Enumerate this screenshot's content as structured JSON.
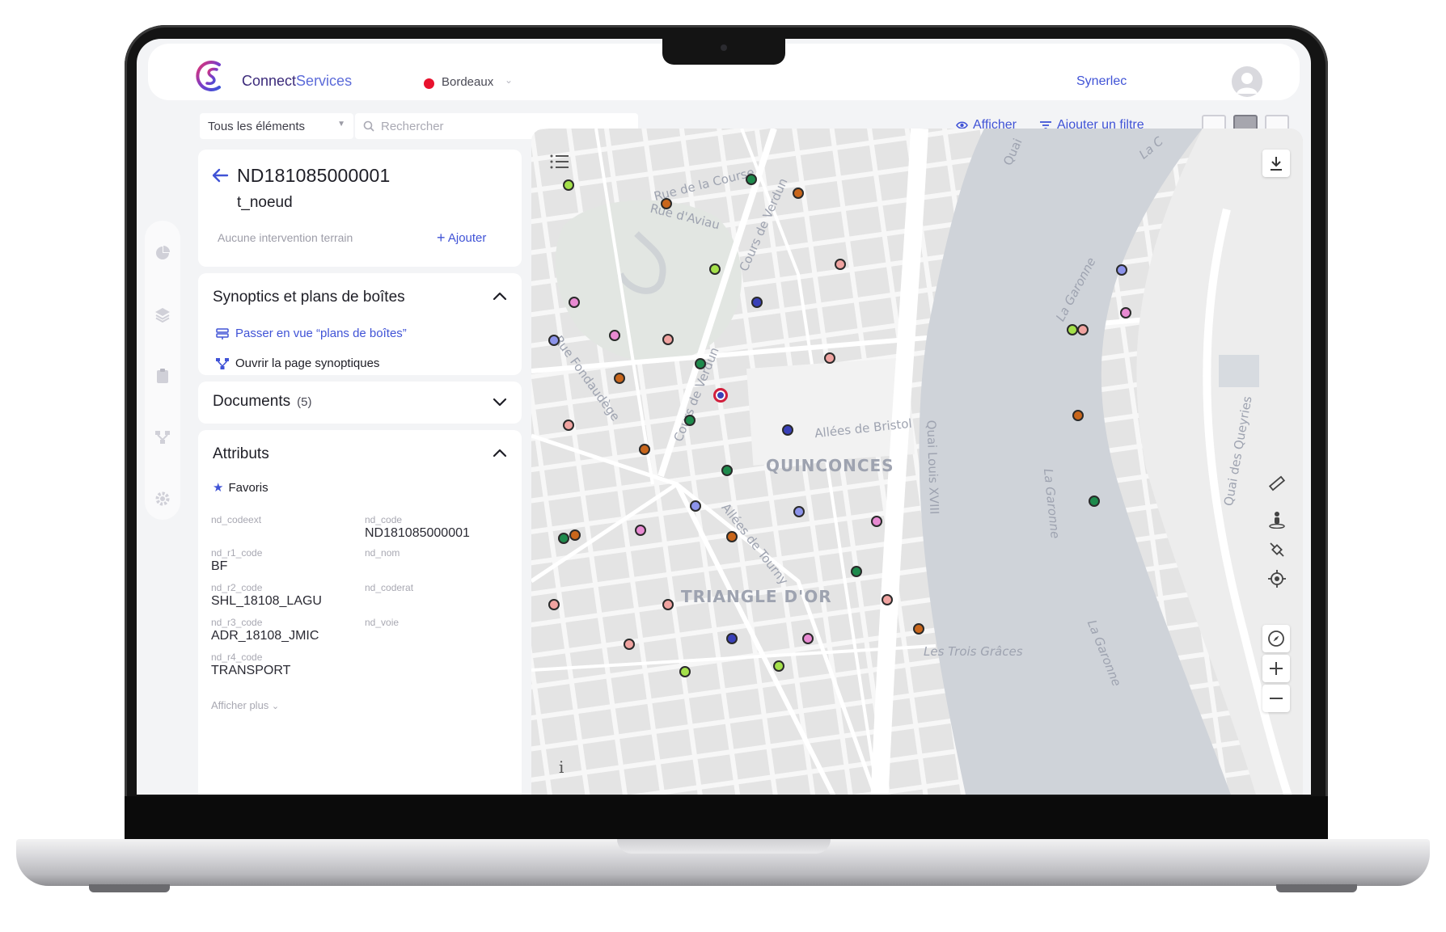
{
  "app": {
    "brand_part1": "Connect",
    "brand_part2": "Services",
    "city": "Bordeaux",
    "organization": "Synerlec"
  },
  "toolbar": {
    "filter_select": "Tous les éléments",
    "search_placeholder": "Rechercher",
    "show_label": "Afficher",
    "add_filter_label": "Ajouter un filtre"
  },
  "node": {
    "id": "ND181085000001",
    "type": "t_noeud",
    "no_intervention": "Aucune intervention terrain",
    "add_label": "Ajouter"
  },
  "synoptics": {
    "title": "Synoptics et plans de boîtes",
    "switch_view_label": "Passer en vue “plans de boîtes”",
    "open_page_label": "Ouvrir la page synoptiques",
    "expanded": true
  },
  "documents": {
    "title": "Documents",
    "count": "(5)",
    "expanded": false
  },
  "attributes": {
    "title": "Attributs",
    "favorites_label": "Favoris",
    "items": [
      {
        "label": "nd_codeext",
        "value": ""
      },
      {
        "label": "nd_code",
        "value": "ND181085000001"
      },
      {
        "label": "nd_r1_code",
        "value": "BF"
      },
      {
        "label": "nd_nom",
        "value": ""
      },
      {
        "label": "nd_r2_code",
        "value": "SHL_18108_LAGU"
      },
      {
        "label": "nd_coderat",
        "value": ""
      },
      {
        "label": "nd_r3_code",
        "value": "ADR_18108_JMIC"
      },
      {
        "label": "nd_voie",
        "value": ""
      },
      {
        "label": "nd_r4_code",
        "value": "TRANSPORT"
      }
    ],
    "show_more": "Afficher plus"
  },
  "map": {
    "labels": {
      "rue_course": "Rue de la Course",
      "rue_aviau": "Rue d'Aviau",
      "cours_verdun_1": "Cours de Verdun",
      "cours_verdun_2": "Cours de Verdun",
      "rue_fondaudege": "Rue Fondaudège",
      "allees_bristol": "Allées de Bristol",
      "quinconces": "QUINCONCES",
      "quai_louis": "Quai Louis XVIII",
      "allees_tourny": "Allées de Tourny",
      "triangle_or": "TRIANGLE D'OR",
      "trois_graces": "Les Trois Grâces",
      "garonne_1": "La Garonne",
      "garonne_2": "La Garonne",
      "garonne_3": "La Garonne",
      "quai_queyries": "Quai des Queyries",
      "quai_top": "Quai",
      "la_top": "La C",
      "info": "i"
    },
    "marker_colors": {
      "lime": "#a4e04a",
      "green": "#1e8a4c",
      "orange": "#c9661b",
      "salmon": "#f0a3a0",
      "pink": "#e88ad2",
      "blue": "#8c93ea",
      "navy": "#3940b8"
    },
    "selected_marker_color": "#3940b8"
  },
  "colors": {
    "accent": "#4053d6",
    "brand_dark": "#3b2a7a",
    "status_red": "#e8112d"
  },
  "icons": [
    "search-icon",
    "eye-icon",
    "filter-icon",
    "layout-icon",
    "back-arrow-icon",
    "plus-icon",
    "chevron-up-icon",
    "chevron-down-icon",
    "boxes-icon",
    "synoptic-icon",
    "star-icon",
    "list-icon",
    "download-icon",
    "ruler-icon",
    "street-view-icon",
    "satellite-icon",
    "locate-icon",
    "compass-icon",
    "zoom-in-icon",
    "zoom-out-icon",
    "pie-chart-icon",
    "layers-icon",
    "clipboard-icon",
    "network-icon",
    "gear-icon"
  ]
}
